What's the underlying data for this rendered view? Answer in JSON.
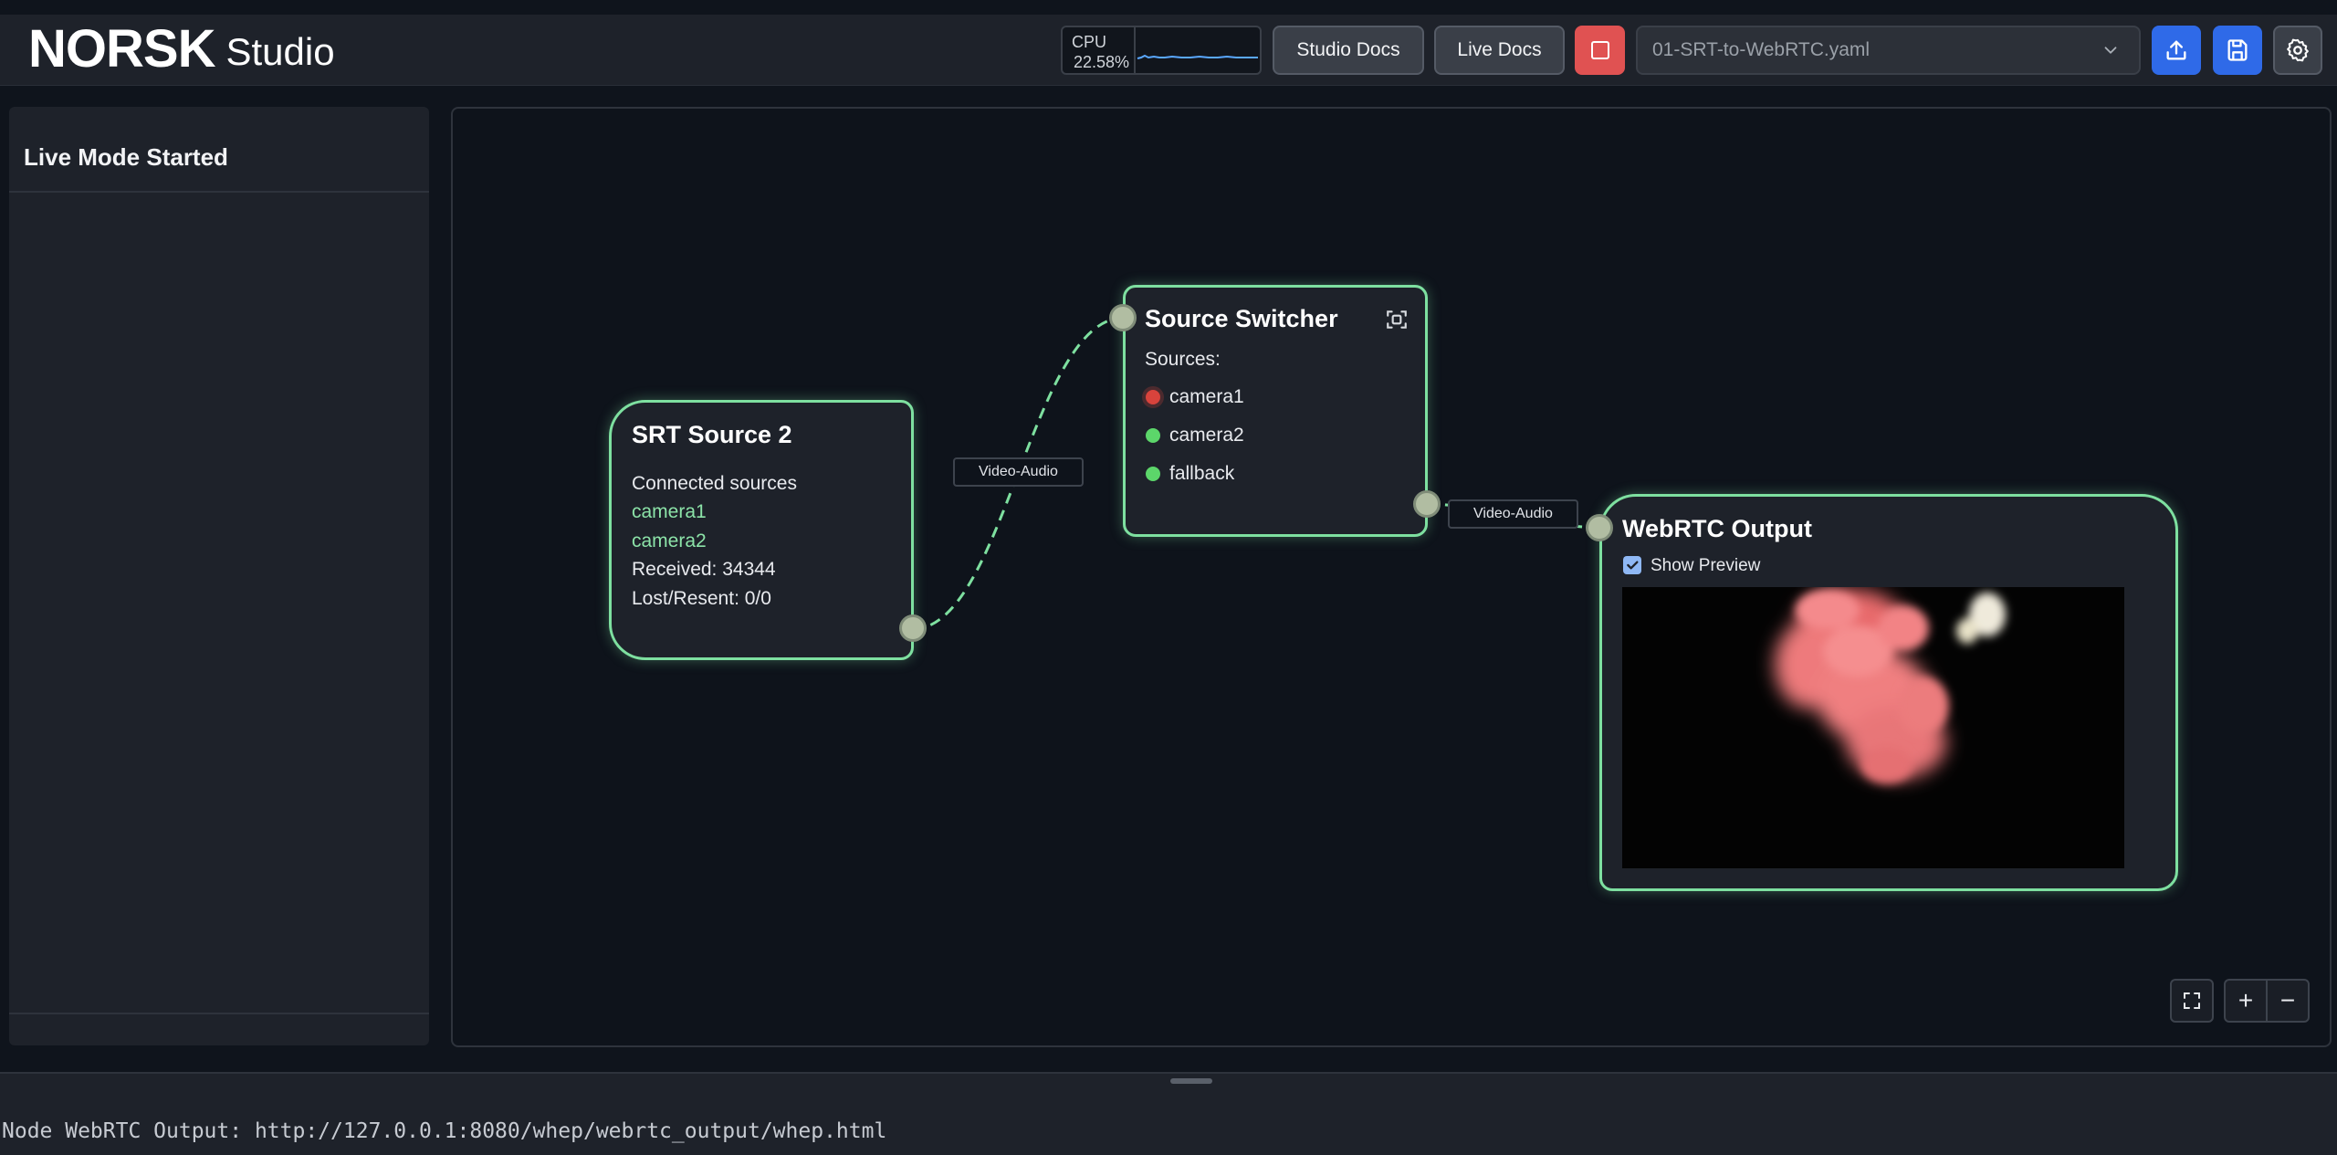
{
  "header": {
    "logo_brand": "NORSK",
    "logo_product": "Studio",
    "cpu": {
      "label": "CPU",
      "value": "22.58%"
    },
    "buttons": {
      "studio_docs": "Studio Docs",
      "live_docs": "Live Docs"
    },
    "file_select": {
      "value": "01-SRT-to-WebRTC.yaml"
    }
  },
  "sidebar": {
    "title": "Live Mode Started"
  },
  "canvas": {
    "srt_node": {
      "title": "SRT Source 2",
      "connected_label": "Connected sources",
      "sources": [
        "camera1",
        "camera2"
      ],
      "received": "Received: 34344",
      "lost_resent": "Lost/Resent: 0/0"
    },
    "edge_labels": [
      "Video-Audio",
      "Video-Audio"
    ],
    "switcher_node": {
      "title": "Source Switcher",
      "sources_label": "Sources:",
      "sources": [
        {
          "name": "camera1",
          "status": "active"
        },
        {
          "name": "camera2",
          "status": "available"
        },
        {
          "name": "fallback",
          "status": "available"
        }
      ]
    },
    "webrtc_node": {
      "title": "WebRTC Output",
      "show_preview_label": "Show Preview",
      "show_preview_checked": true
    },
    "zoom_controls": {
      "zoom_in": "+",
      "zoom_out": "−"
    }
  },
  "log": {
    "line": "Node WebRTC Output: http://127.0.0.1:8080/whep/webrtc_output/whep.html"
  },
  "colors": {
    "accent_blue": "#2f6ae8",
    "stop_red": "#e05252",
    "node_border_green": "#7ee0a0",
    "status_green": "#5cd66a",
    "status_red": "#d8433c"
  }
}
